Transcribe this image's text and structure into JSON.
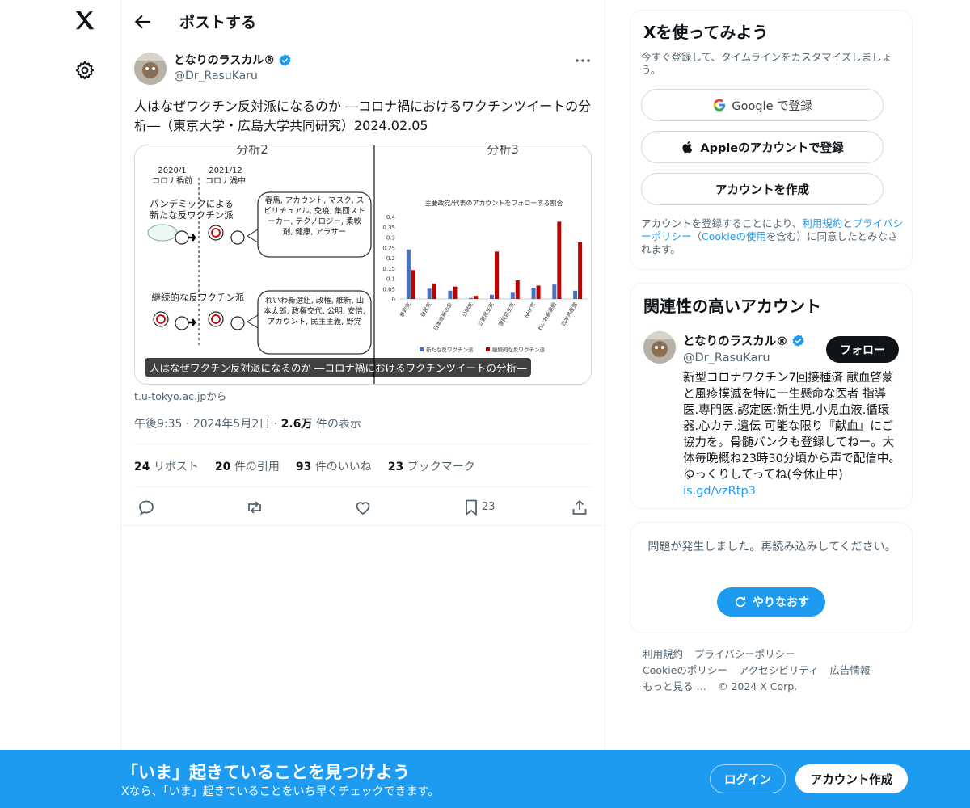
{
  "nav": {
    "logo": "X"
  },
  "header": {
    "title": "ポストする"
  },
  "tweet": {
    "display_name": "となりのラスカル®",
    "handle": "@Dr_RasuKaru",
    "text": "人はなぜワクチン反対派になるのか ―コロナ禍におけるワクチンツイートの分析―（東京大学・広島大学共同研究）2024.02.05",
    "card_caption": "人はなぜワクチン反対派になるのか ―コロナ禍におけるワクチンツイートの分析―",
    "card_domain": "t.u-tokyo.ac.jpから",
    "meta_time": "午後9:35 · 2024年5月2日 ·",
    "views_count": "2.6万",
    "views_label": "件の表示",
    "stats": {
      "reposts": "24",
      "reposts_label": "リポスト",
      "quotes": "20",
      "quotes_label": "件の引用",
      "likes": "93",
      "likes_label": "件のいいね",
      "bookmarks": "23",
      "bookmarks_label": "ブックマーク"
    },
    "bookmark_count": "23"
  },
  "card_image": {
    "left_title": "分析2",
    "right_title": "分析3",
    "col1_date": "2020/1",
    "col1_label": "コロナ禍前",
    "col2_date": "2021/12",
    "col2_label": "コロナ渦中",
    "group1_label": "パンデミックによる\n新たな反ワクチン派",
    "group1_bubble": "春馬, アカウント, マスク, スピリチュアル, 免疫, 集団ストーカー, テクノロジー, 柔軟剤, 健康, アラサー",
    "group2_label": "継続的な反ワクチン派",
    "group2_bubble": "れいわ新選組, 政権, 維新, 山本太郎, 政権交代, 公明, 安倍, アカウント, 民主主義, 野党"
  },
  "chart_data": {
    "type": "bar",
    "title": "主要政党/代表のアカウントをフォローする割合",
    "categories": [
      "参政党",
      "自民党",
      "日本維新の会",
      "公明党",
      "立憲民主党",
      "国民民主党",
      "NHK党",
      "れいわ新選組",
      "日本共産党"
    ],
    "series": [
      {
        "name": "新たな反ワクチン派",
        "color": "#4472c4",
        "values": [
          0.24,
          0.05,
          0.04,
          0.005,
          0.02,
          0.03,
          0.055,
          0.07,
          0.04
        ]
      },
      {
        "name": "継続的な反ワクチン派",
        "color": "#c00000",
        "values": [
          0.14,
          0.075,
          0.06,
          0.015,
          0.23,
          0.09,
          0.065,
          0.375,
          0.275
        ]
      }
    ],
    "yticks": [
      "0",
      "0.05",
      "0.1",
      "0.15",
      "0.2",
      "0.25",
      "0.3",
      "0.35",
      "0.4"
    ],
    "ylim": [
      0,
      0.4
    ],
    "legend_position": "bottom"
  },
  "signup": {
    "title": "Xを使ってみよう",
    "subtitle": "今すぐ登録して、タイムラインをカスタマイズしましょう。",
    "google_label": "Google で登録",
    "apple_label": "Appleのアカウントで登録",
    "create_label": "アカウントを作成",
    "legal_prefix": "アカウントを登録することにより、",
    "legal_terms": "利用規約",
    "legal_and": "と",
    "legal_privacy": "プライバシーポリシー",
    "legal_mid": "（",
    "legal_cookie": "Cookieの使用",
    "legal_suffix": "を含む）に同意したとみなされます。"
  },
  "relevant": {
    "title": "関連性の高いアカウント",
    "name": "となりのラスカル®",
    "handle": "@Dr_RasuKaru",
    "follow_label": "フォロー",
    "bio": "新型コロナワクチン7回接種済 献血啓蒙と風疹撲滅を特に一生懸命な医者 指導医.専門医.認定医:新生児.小児血液.循環器.心カテ.遺伝 可能な限り『献血』にご協力を。骨髄バンクも登録してねー。大体毎晩概ね23時30分頃から声で配信中。ゆっくりしてってね(今休止中)",
    "bio_link": "is.gd/vzRtp3"
  },
  "error": {
    "message": "問題が発生しました。再読み込みしてください。",
    "retry_label": "やりなおす"
  },
  "footer": {
    "terms": "利用規約",
    "privacy": "プライバシーポリシー",
    "cookie": "Cookieのポリシー",
    "accessibility": "アクセシビリティ",
    "ads": "広告情報",
    "more": "もっと見る …",
    "copyright": "© 2024 X Corp."
  },
  "banner": {
    "title": "「いま」起きていることを見つけよう",
    "subtitle": "Xなら、「いま」起きていることをいち早くチェックできます。",
    "login_label": "ログイン",
    "signup_label": "アカウント作成"
  },
  "colors": {
    "accent": "#1d9bf0",
    "text": "#0f1419",
    "muted": "#536471",
    "verified": "#1d9bf0"
  }
}
